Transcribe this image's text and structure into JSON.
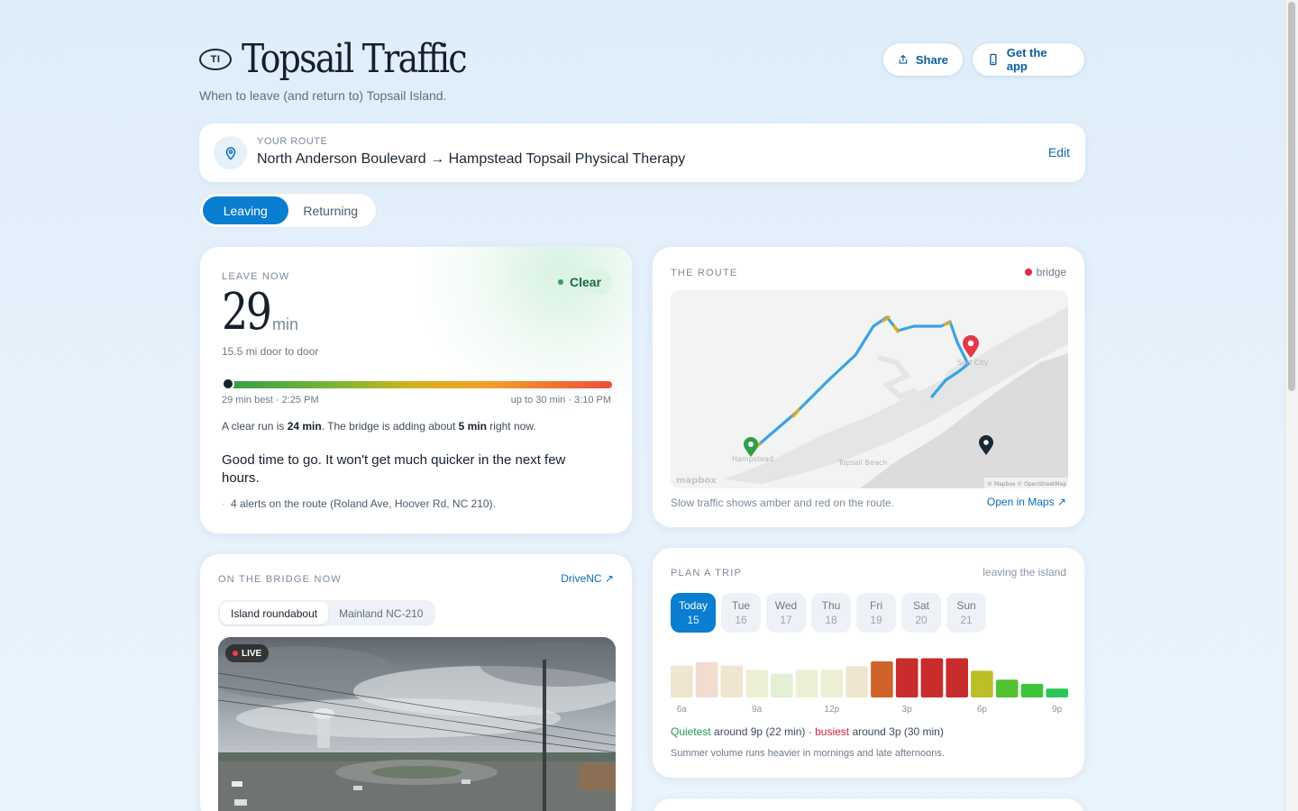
{
  "header": {
    "logo_badge": "TI",
    "title": "Topsail Traffic",
    "tagline": "When to leave (and return to) Topsail Island.",
    "share_label": "Share",
    "app_label": "Get the app"
  },
  "route": {
    "label": "YOUR ROUTE",
    "text": "North Anderson Boulevard → Hampstead Topsail Physical Therapy",
    "edit_label": "Edit"
  },
  "direction": {
    "leaving": "Leaving",
    "returning": "Returning",
    "selected": "Leaving"
  },
  "leave_now": {
    "label": "LEAVE NOW",
    "status": "Clear",
    "minutes": "29",
    "unit": "min",
    "distance": "15.5 mi door to door",
    "best": "29 min best · 2:25 PM",
    "worst": "up to 30 min · 3:10 PM",
    "position": 0,
    "clear_run_prefix": "A clear run is ",
    "clear_run_value": "24 min",
    "clear_run_mid": ". The bridge is adding about ",
    "bridge_value": "5 min",
    "clear_run_suffix": " right now.",
    "advice": "Good time to go. It won't get much quicker in the next few hours.",
    "alerts": "4 alerts on the route (Roland Ave, Hoover Rd, NC 210)."
  },
  "route_map": {
    "label": "THE ROUTE",
    "legend": "bridge",
    "map_attribution": "© Mapbox © OpenStreetMap",
    "map_logo": "mapbox",
    "place_hampstead": "Hampstead",
    "place_topsail": "Topsail Beach",
    "place_surf": "Surf City",
    "caption": "Slow traffic shows amber and red on the route.",
    "open_link": "Open in Maps ↗"
  },
  "bridge": {
    "label": "ON THE BRIDGE NOW",
    "link": "DriveNC ↗",
    "tabs": [
      "Island roundabout",
      "Mainland NC-210"
    ],
    "selected_tab": "Island roundabout",
    "live": "LIVE"
  },
  "plan": {
    "label": "PLAN A TRIP",
    "subtitle": "leaving the island",
    "days": [
      {
        "name": "Today",
        "num": "15"
      },
      {
        "name": "Tue",
        "num": "16"
      },
      {
        "name": "Wed",
        "num": "17"
      },
      {
        "name": "Thu",
        "num": "18"
      },
      {
        "name": "Fri",
        "num": "19"
      },
      {
        "name": "Sat",
        "num": "20"
      },
      {
        "name": "Sun",
        "num": "21"
      }
    ],
    "selected_day": "Today",
    "quietest_label": "Quietest",
    "quietest_text": " around 9p (22 min) · ",
    "busiest_label": "busiest",
    "busiest_text": " around 3p (30 min)",
    "note": "Summer volume runs heavier in mornings and late afternoons."
  },
  "chart_data": {
    "type": "bar",
    "title": "",
    "tick_labels": [
      "6a",
      "9a",
      "12p",
      "3p",
      "6p",
      "9p"
    ],
    "values": [
      0.61,
      0.68,
      0.61,
      0.53,
      0.45,
      0.53,
      0.53,
      0.6,
      0.69,
      0.75,
      0.75,
      0.75,
      0.51,
      0.34,
      0.26,
      0.17
    ],
    "colors": [
      "#f0e6cf",
      "#f1dccf",
      "#f0e6cf",
      "#ecefd3",
      "#e3f0d4",
      "#ecefd3",
      "#ecefd3",
      "#f0e6cf",
      "#cf6328",
      "#c92c2c",
      "#c92c2c",
      "#c92c2c",
      "#bcbf26",
      "#52c232",
      "#3cc43b",
      "#2bc65a"
    ],
    "ylim": [
      0,
      1
    ]
  },
  "colors": {
    "accent": "#0a7ed0",
    "clear": "#2aa360",
    "bridge": "#e3274a"
  }
}
